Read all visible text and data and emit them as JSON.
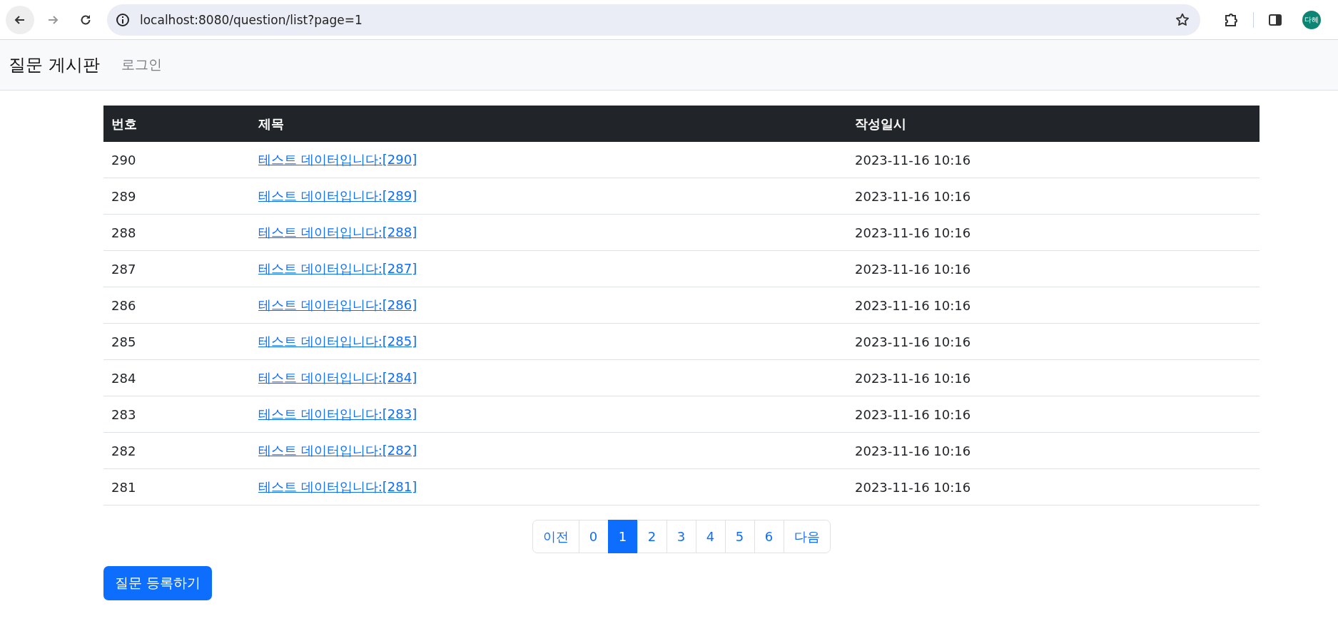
{
  "browser": {
    "url": "localhost:8080/question/list?page=1",
    "profile": "다혜"
  },
  "navbar": {
    "brand": "질문 게시판",
    "links": [
      "로그인"
    ]
  },
  "table": {
    "columns": [
      "번호",
      "제목",
      "작성일시"
    ],
    "rows": [
      {
        "number": "290",
        "title": "테스트 데이터입니다:[290]",
        "date": "2023-11-16 10:16"
      },
      {
        "number": "289",
        "title": "테스트 데이터입니다:[289]",
        "date": "2023-11-16 10:16"
      },
      {
        "number": "288",
        "title": "테스트 데이터입니다:[288]",
        "date": "2023-11-16 10:16"
      },
      {
        "number": "287",
        "title": "테스트 데이터입니다:[287]",
        "date": "2023-11-16 10:16"
      },
      {
        "number": "286",
        "title": "테스트 데이터입니다:[286]",
        "date": "2023-11-16 10:16"
      },
      {
        "number": "285",
        "title": "테스트 데이터입니다:[285]",
        "date": "2023-11-16 10:16"
      },
      {
        "number": "284",
        "title": "테스트 데이터입니다:[284]",
        "date": "2023-11-16 10:16"
      },
      {
        "number": "283",
        "title": "테스트 데이터입니다:[283]",
        "date": "2023-11-16 10:16"
      },
      {
        "number": "282",
        "title": "테스트 데이터입니다:[282]",
        "date": "2023-11-16 10:16"
      },
      {
        "number": "281",
        "title": "테스트 데이터입니다:[281]",
        "date": "2023-11-16 10:16"
      }
    ]
  },
  "pagination": [
    {
      "label": "이전",
      "selected": false
    },
    {
      "label": "0",
      "selected": false
    },
    {
      "label": "1",
      "selected": true
    },
    {
      "label": "2",
      "selected": false
    },
    {
      "label": "3",
      "selected": false
    },
    {
      "label": "4",
      "selected": false
    },
    {
      "label": "5",
      "selected": false
    },
    {
      "label": "6",
      "selected": false
    },
    {
      "label": "다음",
      "selected": false
    }
  ],
  "create_button": "질문 등록하기"
}
